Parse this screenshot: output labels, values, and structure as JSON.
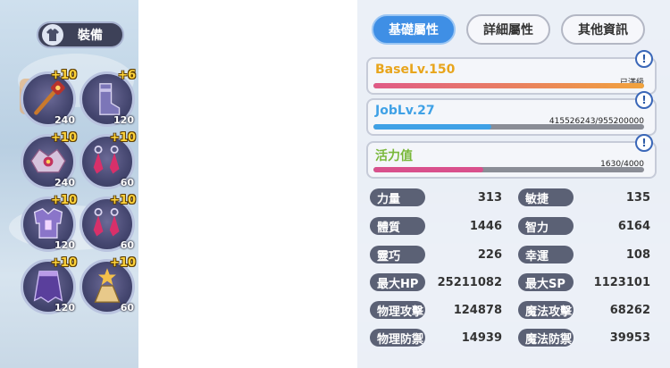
{
  "equip_button": {
    "label": "裝備",
    "icon": "shirt-icon"
  },
  "slots": [
    {
      "item": "staff-icon",
      "refine": "+10",
      "level": "240"
    },
    {
      "item": "boots-icon",
      "refine": "+6",
      "level": "120"
    },
    {
      "item": "headgear-icon",
      "refine": "+10",
      "level": "240"
    },
    {
      "item": "earring-icon",
      "refine": "+10",
      "level": "60"
    },
    {
      "item": "armor-icon",
      "refine": "+10",
      "level": "120"
    },
    {
      "item": "earring-icon",
      "refine": "+10",
      "level": "60"
    },
    {
      "item": "cape-icon",
      "refine": "+10",
      "level": "120"
    },
    {
      "item": "accessory-icon",
      "refine": "+10",
      "level": "60"
    }
  ],
  "tabs": [
    {
      "label": "基礎屬性",
      "active": true
    },
    {
      "label": "詳細屬性",
      "active": false
    },
    {
      "label": "其他資訊",
      "active": false
    }
  ],
  "base_level": {
    "label": "BaseLv.150",
    "status": "已滿級",
    "progress": 1.0,
    "color": "#e8a51c"
  },
  "job_level": {
    "label": "JobLv.27",
    "exp": "415526243/955200000",
    "progress": 0.435,
    "color": "#3fa1e6"
  },
  "vitality": {
    "label": "活力值",
    "value": "1630/4000",
    "progress": 0.4075,
    "color": "#79b83a"
  },
  "info_symbol": "!",
  "stats": [
    {
      "label": "力量",
      "value": "313"
    },
    {
      "label": "敏捷",
      "value": "135"
    },
    {
      "label": "體質",
      "value": "1446"
    },
    {
      "label": "智力",
      "value": "6164"
    },
    {
      "label": "靈巧",
      "value": "226"
    },
    {
      "label": "幸運",
      "value": "108"
    },
    {
      "label": "最大HP",
      "value": "25211082"
    },
    {
      "label": "最大SP",
      "value": "1123101"
    },
    {
      "label": "物理攻擊",
      "value": "124878"
    },
    {
      "label": "魔法攻擊",
      "value": "68262"
    },
    {
      "label": "物理防禦",
      "value": "14939"
    },
    {
      "label": "魔法防禦",
      "value": "39953"
    }
  ]
}
